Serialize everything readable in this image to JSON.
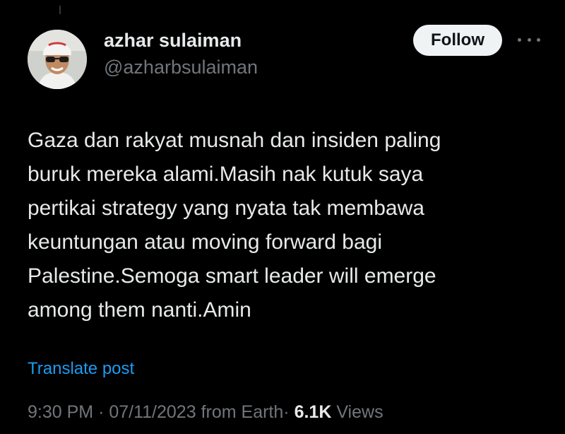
{
  "author": {
    "name": "azhar sulaiman",
    "handle": "@azharbsulaiman"
  },
  "actions": {
    "follow_label": "Follow",
    "more_icon": "more-horizontal-icon"
  },
  "post": {
    "text": "Gaza dan rakyat musnah dan insiden paling\nburuk mereka alami.Masih nak kutuk saya\npertikai strategy yang nyata tak membawa\nkeuntungan atau moving forward bagi\nPalestine.Semoga smart leader will emerge\namong them nanti.Amin",
    "translate_label": "Translate post"
  },
  "meta": {
    "time": "9:30 PM",
    "separator": "·",
    "date": "07/11/2023",
    "source": "from Earth",
    "views_count": "6.1K",
    "views_label": "Views"
  },
  "colors": {
    "background": "#000000",
    "text_primary": "#e7e9ea",
    "text_secondary": "#71767b",
    "link": "#1d9bf0",
    "follow_bg": "#eff3f4"
  }
}
